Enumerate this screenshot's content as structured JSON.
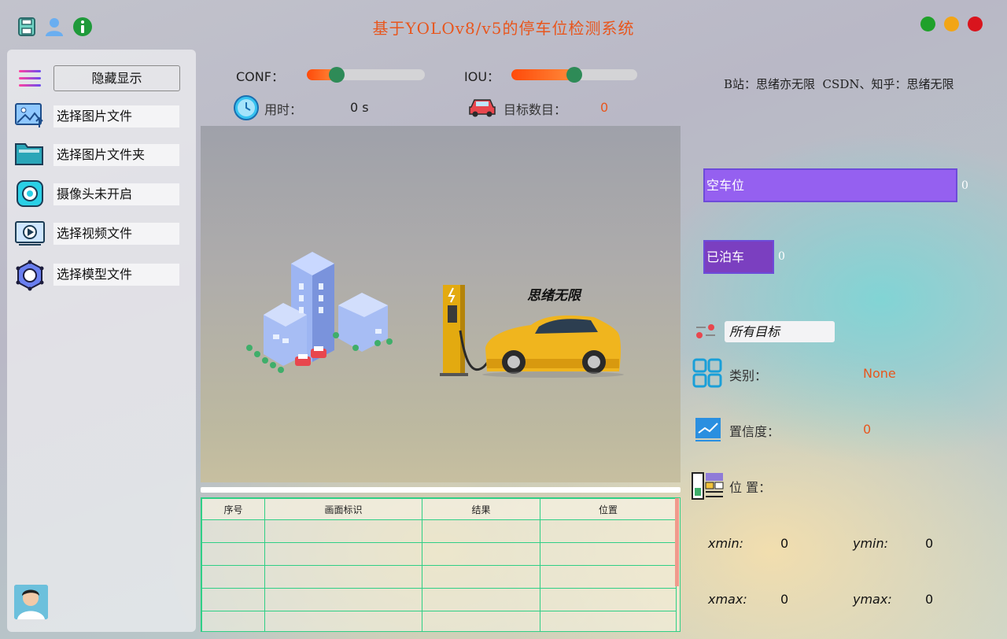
{
  "app": {
    "title": "基于YOLOv8/v5的停车位检测系统",
    "top_icons": [
      "save-icon",
      "user-icon",
      "info-icon"
    ],
    "window_buttons": [
      {
        "name": "maximize",
        "color": "#1fa12a"
      },
      {
        "name": "minimize",
        "color": "#f2a516"
      },
      {
        "name": "close",
        "color": "#d9141d"
      }
    ]
  },
  "sidebar": {
    "toggle_label": "隐藏显示",
    "items": [
      {
        "label": "选择图片文件",
        "icon": "image-upload-icon"
      },
      {
        "label": "选择图片文件夹",
        "icon": "folder-icon"
      },
      {
        "label": "摄像头未开启",
        "icon": "camera-icon"
      },
      {
        "label": "选择视频文件",
        "icon": "video-icon"
      },
      {
        "label": "选择模型文件",
        "icon": "model-icon"
      }
    ],
    "avatar_icon": "avatar"
  },
  "controls": {
    "conf_label": "CONF：",
    "conf_value": 0.25,
    "iou_label": "IOU：",
    "iou_value": 0.5,
    "time_label": "用时：",
    "time_value": "0 s",
    "target_count_label": "目标数目：",
    "target_count_value": "0"
  },
  "credits": "B站：思绪亦无限  CSDN、知乎：思绪无限",
  "display": {
    "watermark": "思绪无限"
  },
  "table": {
    "headers": [
      "序号",
      "画面标识",
      "结果",
      "位置"
    ],
    "rows": [
      [
        "",
        "",
        "",
        ""
      ],
      [
        "",
        "",
        "",
        ""
      ],
      [
        "",
        "",
        "",
        ""
      ],
      [
        "",
        "",
        "",
        ""
      ],
      [
        "",
        "",
        "",
        ""
      ]
    ]
  },
  "stats": {
    "empty_label": "空车位",
    "empty_count": "0",
    "empty_color": "#9560f0",
    "parked_label": "已泊车",
    "parked_count": "0",
    "parked_color": "#7b3fc0"
  },
  "details": {
    "target_select": "所有目标",
    "category_label": "类别：",
    "category_value": "None",
    "confidence_label": "置信度：",
    "confidence_value": "0",
    "position_label": "位 置：",
    "xmin_label": "xmin:",
    "xmin_value": "0",
    "ymin_label": "ymin:",
    "ymin_value": "0",
    "xmax_label": "xmax:",
    "xmax_value": "0",
    "ymax_label": "ymax:",
    "ymax_value": "0"
  }
}
